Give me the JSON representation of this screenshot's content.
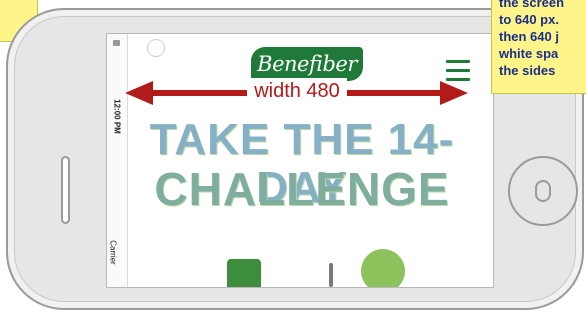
{
  "phone": {
    "status_time": "12:00 PM",
    "status_carrier": "Carrier"
  },
  "site": {
    "logo_text": "Benefiber",
    "hero_line1": "TAKE THE 14-DAY",
    "hero_line2": "CHALLENGE"
  },
  "annotation": {
    "width_label": "width 480",
    "note_lines": [
      "the screen",
      "to 640 px.",
      "then 640 j",
      "white spa",
      "the sides"
    ],
    "arrow_color": "#b31b1b",
    "note_bg": "#fdf58a",
    "note_text_color": "#1b2f8a"
  },
  "colors": {
    "brand_green": "#1f7a3a"
  },
  "icons": [
    "lock-icon",
    "menu-icon",
    "home-button-icon"
  ]
}
